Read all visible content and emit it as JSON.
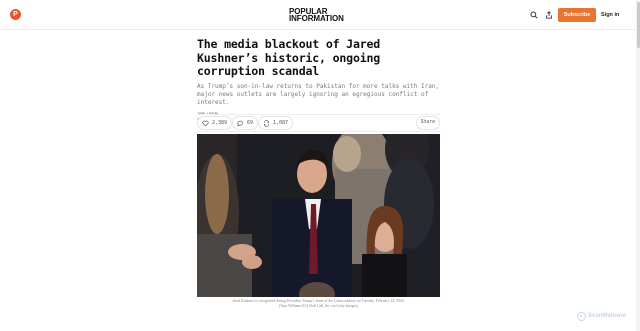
{
  "header": {
    "logo_letter": "P",
    "brand_line1": "POPULAR",
    "brand_line2": "INFORMATION",
    "subscribe_label": "Subscribe",
    "signin_label": "Sign in",
    "accent_color": "#e8742f",
    "icons": [
      "search-icon",
      "share-icon"
    ]
  },
  "article": {
    "title": "The media blackout of Jared Kushner’s historic, ongoing corruption scandal",
    "subtitle": "As Trump’s son-in-law returns to Pakistan for more talks with Iran, major news outlets are largely ignoring an egregious conflict of interest.",
    "author": "JUDD LEGUM",
    "date": "APR 20, 2026",
    "likes": "2,389",
    "comments": "69",
    "restacks": "1,087",
    "share_label": "Share",
    "photo_caption": "Jared Kushner is recognized during President Trump’s State of the Union address on Tuesday, February 24, 2026. (Tom Williams/CQ-Roll Call, Inc via Getty Images)"
  },
  "watermark": {
    "label": "ScanMalware"
  }
}
